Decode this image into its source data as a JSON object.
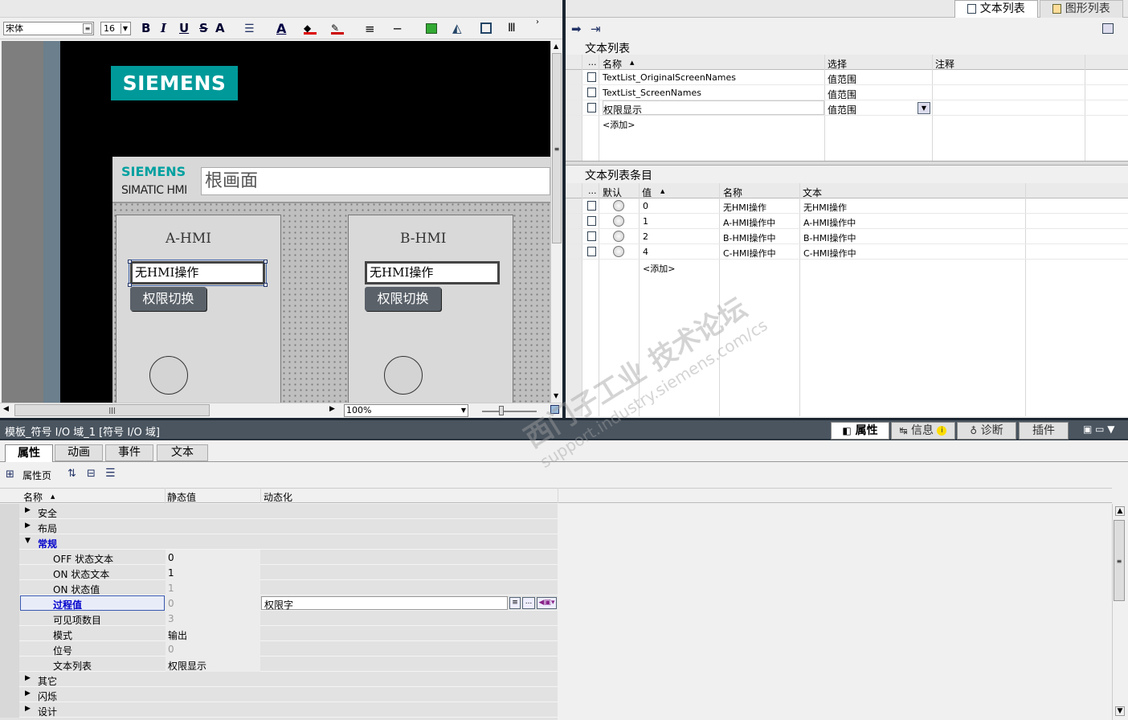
{
  "toolbar": {
    "font_name": "宋体",
    "font_size": "16",
    "bold": "B",
    "italic": "I",
    "underline": "U",
    "strike": "S",
    "grow": "A"
  },
  "right_tabs": {
    "text_list": "文本列表",
    "graphic_list": "图形列表"
  },
  "canvas": {
    "brand": "SIEMENS",
    "brand_small": "SIEMENS",
    "product": "SIMATIC HMI",
    "screen_title": "根画面",
    "left_panel": {
      "title": "A-HMI",
      "io_value": "无HMI操作",
      "button": "权限切换"
    },
    "right_panel": {
      "title": "B-HMI",
      "io_value": "无HMI操作",
      "button": "权限切换"
    },
    "zoom": "100%"
  },
  "text_lists": {
    "header": "文本列表",
    "columns": {
      "dots": "...",
      "name": "名称",
      "select": "选择",
      "comment": "注释"
    },
    "rows": [
      {
        "name": "TextList_OriginalScreenNames",
        "select": "值范围"
      },
      {
        "name": "TextList_ScreenNames",
        "select": "值范围"
      },
      {
        "name": "权限显示",
        "select": "值范围"
      }
    ],
    "add": "<添加>"
  },
  "entries": {
    "header": "文本列表条目",
    "columns": {
      "dots": "...",
      "default": "默认",
      "value": "值",
      "name": "名称",
      "text": "文本"
    },
    "rows": [
      {
        "value": "0",
        "name": "无HMI操作",
        "text": "无HMI操作"
      },
      {
        "value": "1",
        "name": "A-HMI操作中",
        "text": "A-HMI操作中"
      },
      {
        "value": "2",
        "name": "B-HMI操作中",
        "text": "B-HMI操作中"
      },
      {
        "value": "4",
        "name": "C-HMI操作中",
        "text": "C-HMI操作中"
      }
    ],
    "add": "<添加>"
  },
  "inspector": {
    "title": "模板_符号 I/O 域_1 [符号 I/O 域]",
    "right_tabs": {
      "properties": "属性",
      "info": "信息",
      "diagnostics": "诊断",
      "plugins": "插件"
    },
    "tabs": {
      "properties": "属性",
      "animation": "动画",
      "events": "事件",
      "text": "文本"
    },
    "properties_page": "属性页",
    "columns": {
      "name": "名称",
      "static": "静态值",
      "dynamic": "动态化"
    },
    "groups": {
      "security": "安全",
      "layout": "布局",
      "general": "常规",
      "other": "其它",
      "flash": "闪烁",
      "design": "设计"
    },
    "props": [
      {
        "name": "OFF 状态文本",
        "value": "0",
        "dyn": ""
      },
      {
        "name": "ON 状态文本",
        "value": "1",
        "dyn": ""
      },
      {
        "name": "ON 状态值",
        "value": "1",
        "dyn": ""
      },
      {
        "name": "过程值",
        "value": "0",
        "dyn": "权限字"
      },
      {
        "name": "可见项数目",
        "value": "3",
        "dyn": ""
      },
      {
        "name": "模式",
        "value": "输出",
        "dyn": ""
      },
      {
        "name": "位号",
        "value": "0",
        "dyn": ""
      },
      {
        "name": "文本列表",
        "value": "权限显示",
        "dyn": ""
      }
    ]
  },
  "watermark": {
    "line1": "西门子工业 技术论坛",
    "line2": "support.industry.siemens.com/cs"
  },
  "colors": {
    "siemens_teal": "#009999",
    "selection_blue": "#0000cc"
  }
}
